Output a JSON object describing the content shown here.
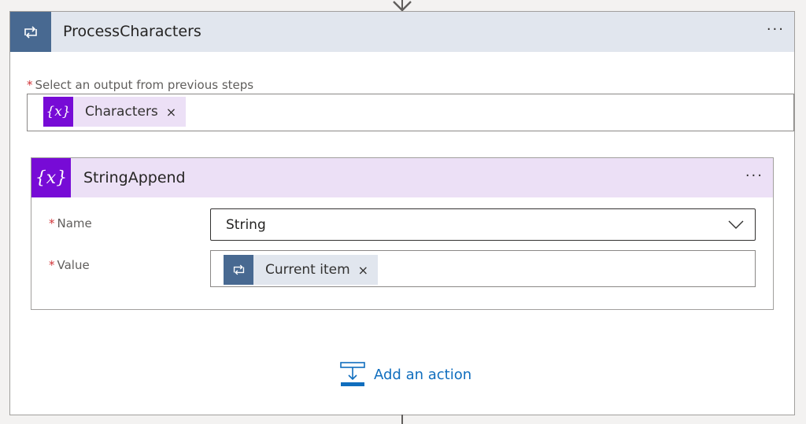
{
  "loop": {
    "title": "ProcessCharacters",
    "menu": "···",
    "icon": "loop-icon",
    "accent": "#486991",
    "required_marker": "*",
    "select_label": "Select an output from previous steps",
    "selected_token": {
      "label": "Characters",
      "icon": "variable-icon",
      "icon_glyph": "{x}",
      "remove": "×"
    }
  },
  "action": {
    "title": "StringAppend",
    "menu": "···",
    "icon": "variable-icon",
    "icon_glyph": "{x}",
    "accent": "#770bd6",
    "fields": {
      "name": {
        "label": "Name",
        "value": "String"
      },
      "value": {
        "label": "Value",
        "token": {
          "label": "Current item",
          "icon": "loop-icon",
          "remove": "×"
        }
      }
    }
  },
  "add_action": {
    "label": "Add an action",
    "icon": "add-action-icon"
  }
}
